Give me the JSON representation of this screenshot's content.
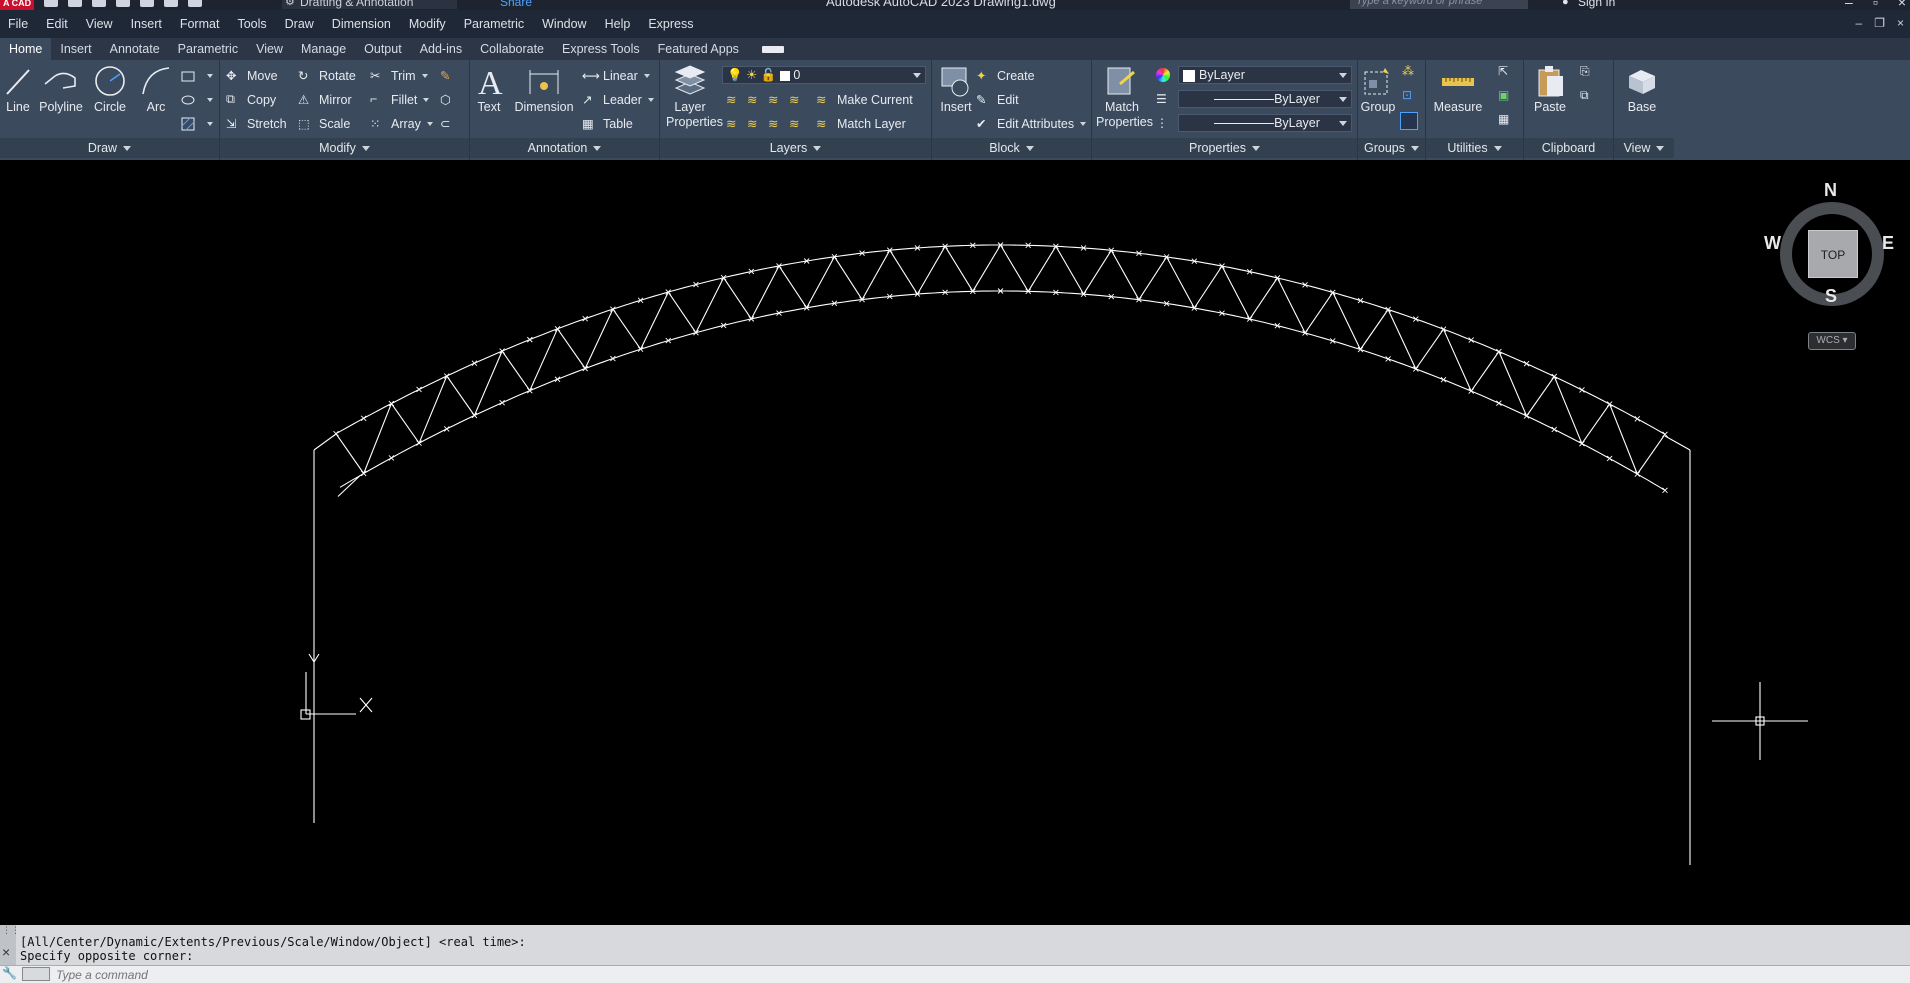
{
  "titlebar": {
    "logo": "A CAD",
    "workspace": "Drafting & Annotation",
    "share": "Share",
    "title": "Autodesk AutoCAD 2023    Drawing1.dwg",
    "search_placeholder": "Type a keyword or phrase",
    "signin": "Sign In"
  },
  "menu": [
    "File",
    "Edit",
    "View",
    "Insert",
    "Format",
    "Tools",
    "Draw",
    "Dimension",
    "Modify",
    "Parametric",
    "Window",
    "Help",
    "Express"
  ],
  "ribbon_tabs": [
    "Home",
    "Insert",
    "Annotate",
    "Parametric",
    "View",
    "Manage",
    "Output",
    "Add-ins",
    "Collaborate",
    "Express Tools",
    "Featured Apps"
  ],
  "active_tab": "Home",
  "panels": {
    "draw": {
      "title": "Draw",
      "line": "Line",
      "polyline": "Polyline",
      "circle": "Circle",
      "arc": "Arc"
    },
    "modify": {
      "title": "Modify",
      "move": "Move",
      "rotate": "Rotate",
      "trim": "Trim",
      "copy": "Copy",
      "mirror": "Mirror",
      "fillet": "Fillet",
      "stretch": "Stretch",
      "scale": "Scale",
      "array": "Array"
    },
    "annotation": {
      "title": "Annotation",
      "text": "Text",
      "dimension": "Dimension",
      "linear": "Linear",
      "leader": "Leader",
      "table": "Table"
    },
    "layers": {
      "title": "Layers",
      "layer_properties": "Layer Properties",
      "current_layer": "0",
      "make_current": "Make Current",
      "match_layer": "Match Layer"
    },
    "block": {
      "title": "Block",
      "insert": "Insert",
      "create": "Create",
      "edit": "Edit",
      "edit_attributes": "Edit Attributes"
    },
    "properties": {
      "title": "Properties",
      "match_properties": "Match Properties",
      "color": "ByLayer",
      "linetype": "ByLayer",
      "lineweight": "ByLayer"
    },
    "groups": {
      "title": "Groups",
      "group": "Group"
    },
    "utilities": {
      "title": "Utilities",
      "measure": "Measure"
    },
    "clipboard": {
      "title": "Clipboard",
      "paste": "Paste"
    },
    "view": {
      "title": "View",
      "base": "Base"
    }
  },
  "viewcube": {
    "n": "N",
    "s": "S",
    "e": "E",
    "w": "W",
    "face": "TOP",
    "wcs": "WCS"
  },
  "command": {
    "history": [
      "[All/Center/Dynamic/Extents/Previous/Scale/Window/Object] <real time>:",
      "Specify opposite corner:"
    ],
    "placeholder": "Type a command"
  },
  "colors": {
    "ribbon_bg": "#3c4a5e",
    "menubar_bg": "#1f2836",
    "canvas_bg": "#000000",
    "geometry": "#ffffff"
  }
}
